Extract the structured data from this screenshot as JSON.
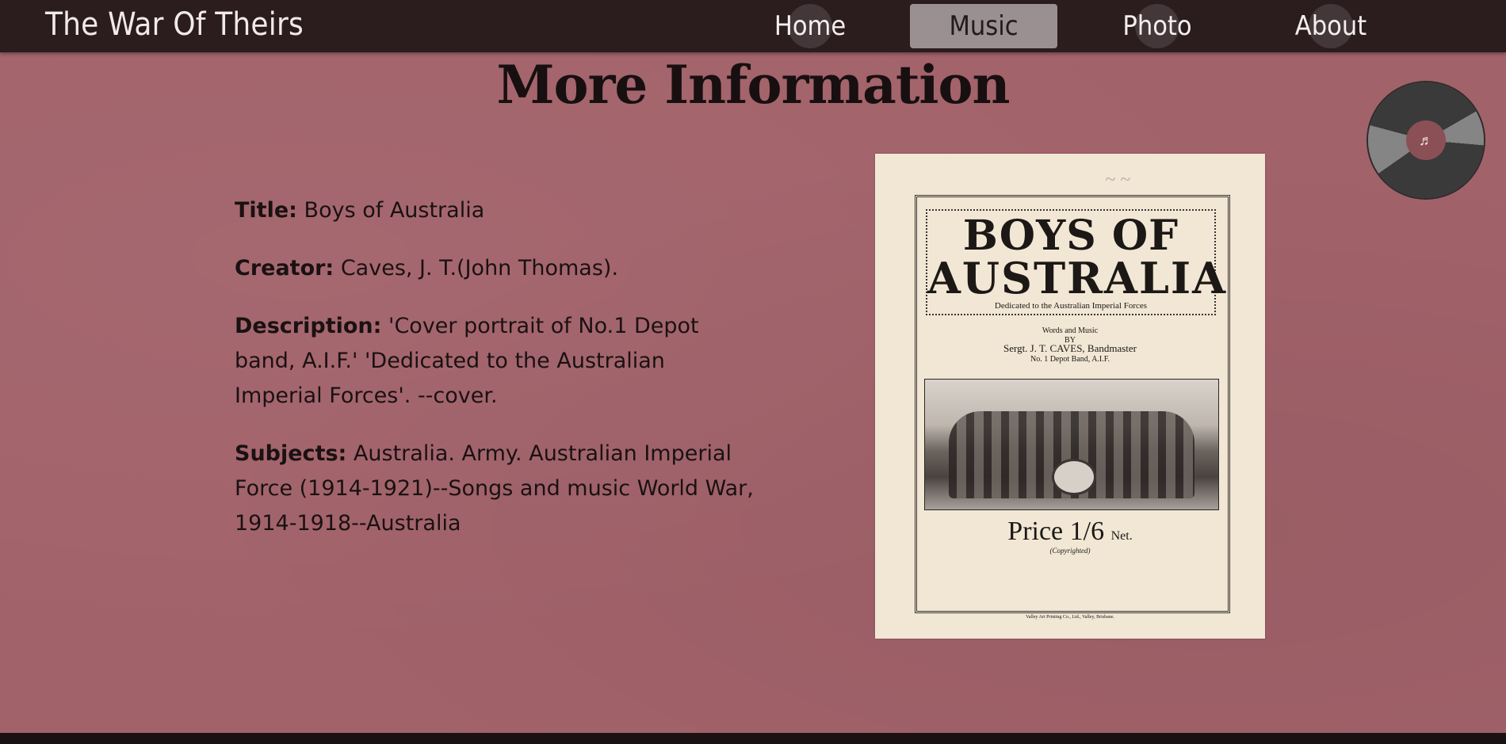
{
  "site": {
    "brand": "The War Of Theirs"
  },
  "nav": {
    "items": [
      {
        "label": "Home",
        "active": false
      },
      {
        "label": "Music",
        "active": true
      },
      {
        "label": "Photo",
        "active": false
      },
      {
        "label": "About",
        "active": false
      }
    ]
  },
  "heading": "More Information",
  "info": {
    "title_label": "Title:",
    "title_value": "Boys of Australia",
    "creator_label": "Creator:",
    "creator_value": "Caves, J. T.(John Thomas).",
    "description_label": "Description:",
    "description_value": "'Cover portrait of No.1 Depot band, A.I.F.' 'Dedicated to the Australian Imperial Forces'. --cover.",
    "subjects_label": "Subjects:",
    "subjects_value": "Australia. Army. Australian Imperial Force (1914-1921)--Songs and music World War, 1914-1918--Australia"
  },
  "cover": {
    "title_line1": "BOYS OF",
    "title_line2": "AUSTRALIA",
    "dedication": "Dedicated to the Australian Imperial Forces",
    "words_line": "Words and Music",
    "by_line": "BY",
    "author": "Sergt. J. T. CAVES, Bandmaster",
    "depot": "No. 1 Depot Band, A.I.F.",
    "price": "Price 1/6",
    "price_suffix": "Net.",
    "copyright": "(Copyrighted)",
    "printer": "Valley Art Printing Co., Ltd., Valley, Brisbane."
  },
  "icons": {
    "record": "vinyl-record-icon",
    "note": "music-note-icon"
  },
  "colors": {
    "nav_bg": "#2b1c1e",
    "page_bg": "#a2626a",
    "active_tab": "#9a8f91"
  }
}
